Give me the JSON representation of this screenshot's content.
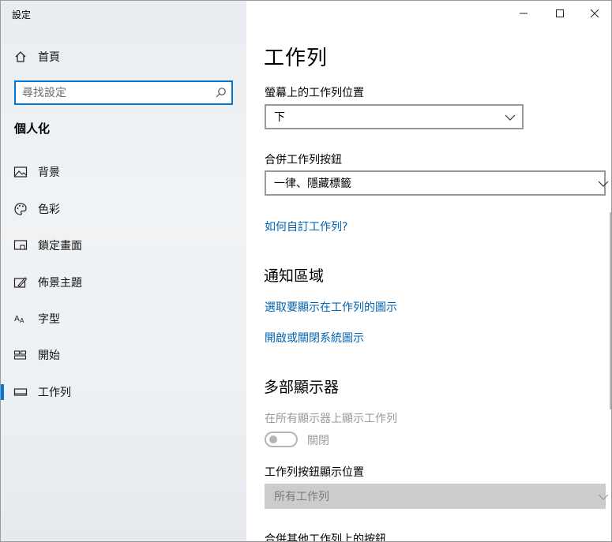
{
  "window": {
    "title": "設定",
    "controls": [
      "minimize-icon",
      "maximize-icon",
      "close-icon"
    ]
  },
  "sidebar": {
    "home_label": "首頁",
    "search_placeholder": "尋找設定",
    "section_title": "個人化",
    "items": [
      {
        "label": "背景",
        "icon": "picture-icon"
      },
      {
        "label": "色彩",
        "icon": "palette-icon"
      },
      {
        "label": "鎖定畫面",
        "icon": "lock-screen-icon"
      },
      {
        "label": "佈景主題",
        "icon": "brush-icon"
      },
      {
        "label": "字型",
        "icon": "font-icon"
      },
      {
        "label": "開始",
        "icon": "start-icon"
      },
      {
        "label": "工作列",
        "icon": "taskbar-icon",
        "active": true
      }
    ]
  },
  "main": {
    "title": "工作列",
    "location_label": "螢幕上的工作列位置",
    "location_value": "下",
    "combine_label": "合併工作列按鈕",
    "combine_value": "一律、隱藏標籤",
    "customize_link": "如何自訂工作列?",
    "notification_head": "通知區域",
    "select_icons_link": "選取要顯示在工作列的圖示",
    "system_icons_link": "開啟或關閉系統圖示",
    "multi_head": "多部顯示器",
    "show_all_label": "在所有顯示器上顯示工作列",
    "toggle_state": "關閉",
    "buttons_position_label": "工作列按鈕顯示位置",
    "buttons_position_value": "所有工作列",
    "combine_other_label": "合併其他工作列上的按鈕"
  },
  "colors": {
    "accent": "#0078d7",
    "link": "#0063b1",
    "disabled_text": "#9a9a9a"
  }
}
